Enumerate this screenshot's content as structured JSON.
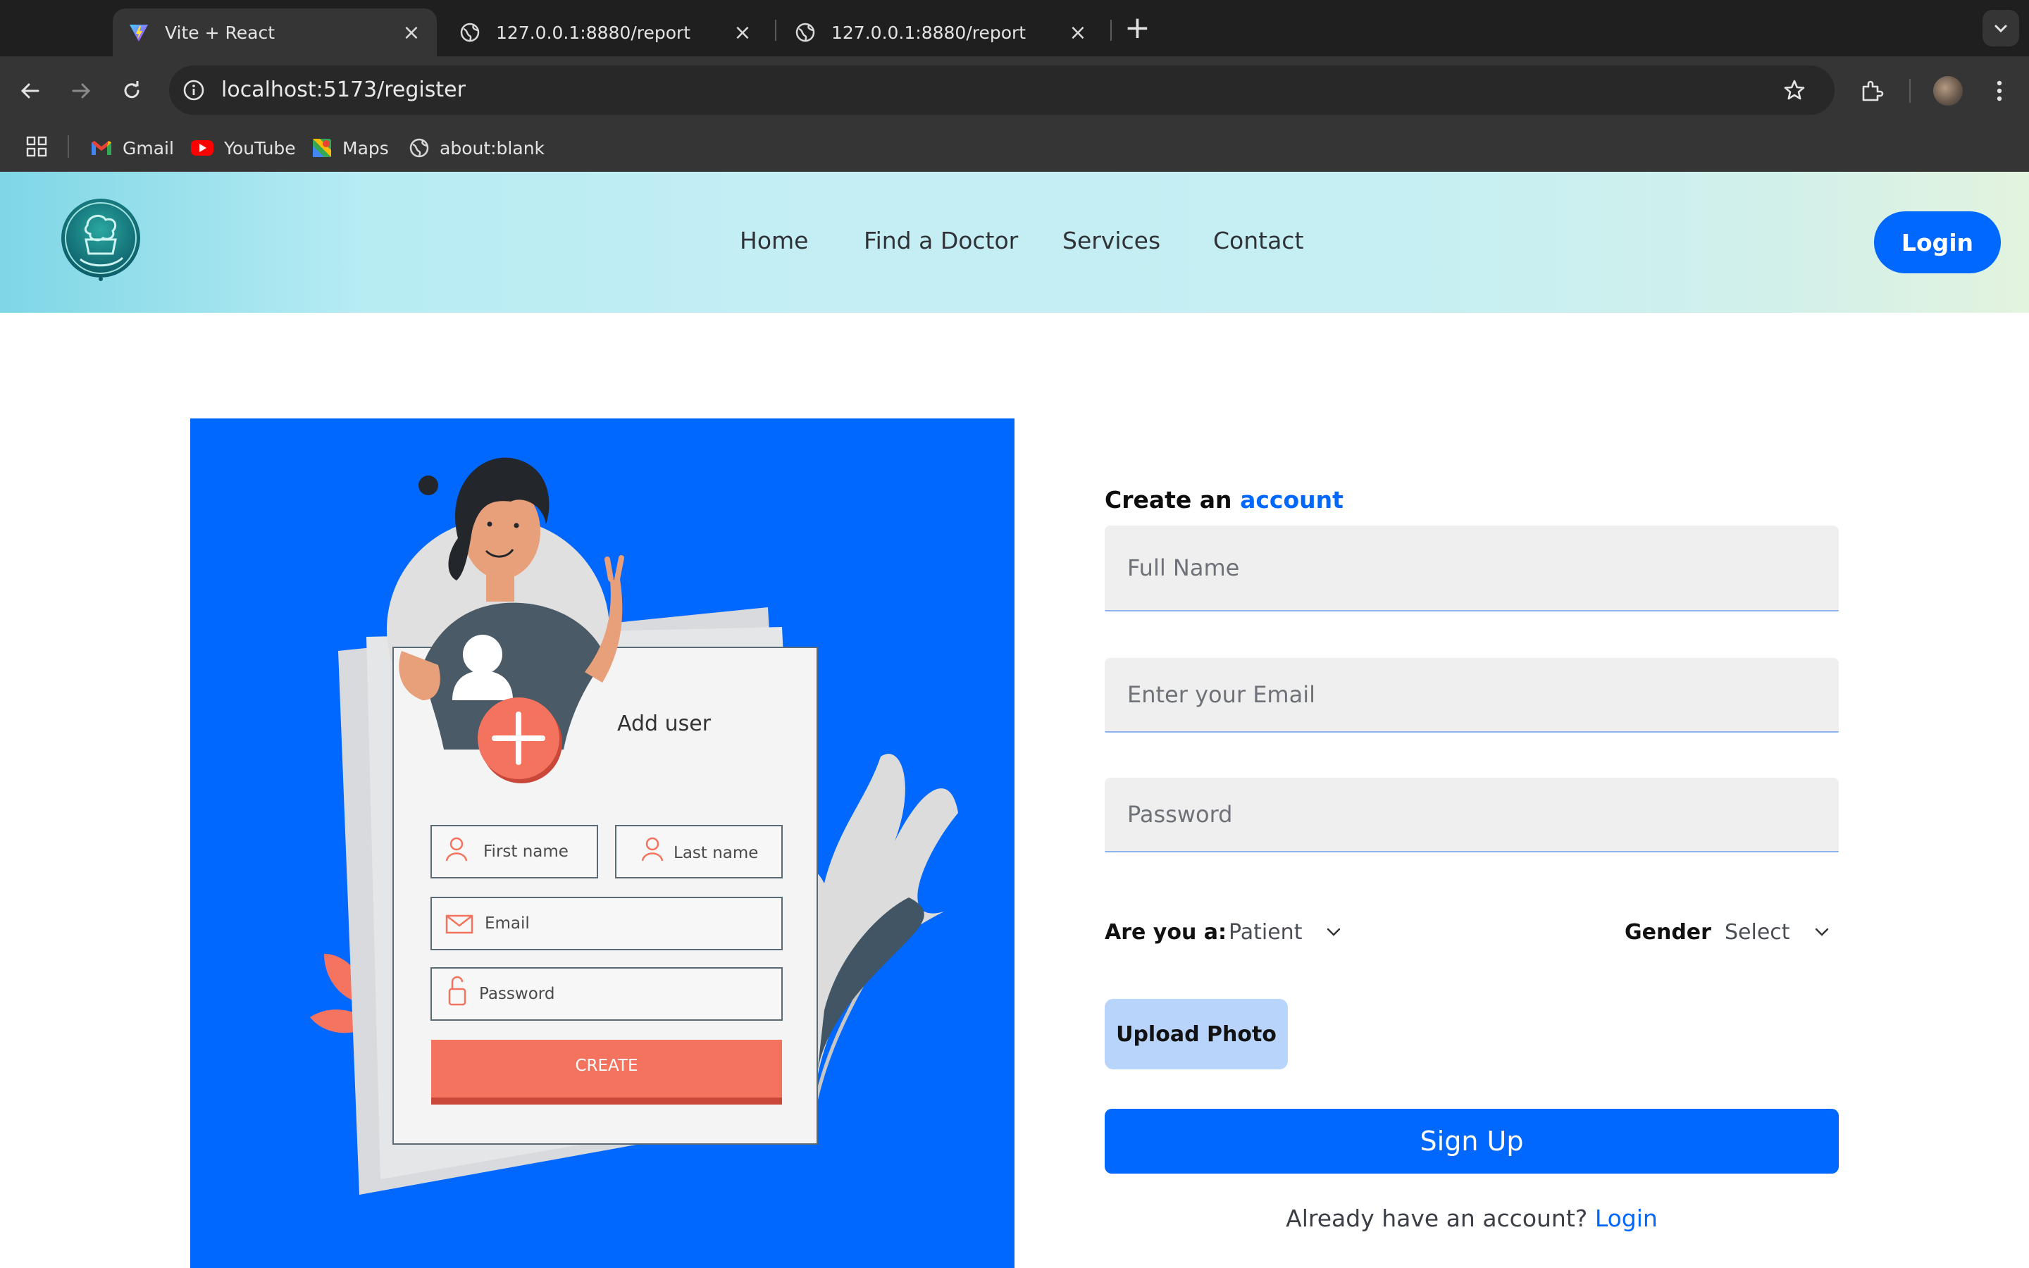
{
  "browser": {
    "tabs": [
      {
        "title": "Vite + React",
        "active": true
      },
      {
        "title": "127.0.0.1:8880/report",
        "active": false
      },
      {
        "title": "127.0.0.1:8880/report",
        "active": false
      }
    ],
    "address": "localhost:5173/register",
    "bookmarks": [
      "Gmail",
      "YouTube",
      "Maps",
      "about:blank"
    ]
  },
  "header": {
    "nav": [
      "Home",
      "Find a Doctor",
      "Services",
      "Contact"
    ],
    "login_label": "Login",
    "accent_color": "#0067ff"
  },
  "illustration": {
    "card_title": "Add user",
    "first_name": "First name",
    "last_name": "Last name",
    "email": "Email",
    "password": "Password",
    "create_label": "CREATE"
  },
  "form": {
    "title_prefix": "Create an",
    "title_accent": "account",
    "full_name_placeholder": "Full Name",
    "email_placeholder": "Enter your Email",
    "password_placeholder": "Password",
    "role_label": "Are you a:",
    "role_value": "Patient",
    "gender_label": "Gender",
    "gender_value": "Select",
    "upload_label": "Upload Photo",
    "submit_label": "Sign Up",
    "already_text": "Already have an account?",
    "login_link": "Login"
  }
}
